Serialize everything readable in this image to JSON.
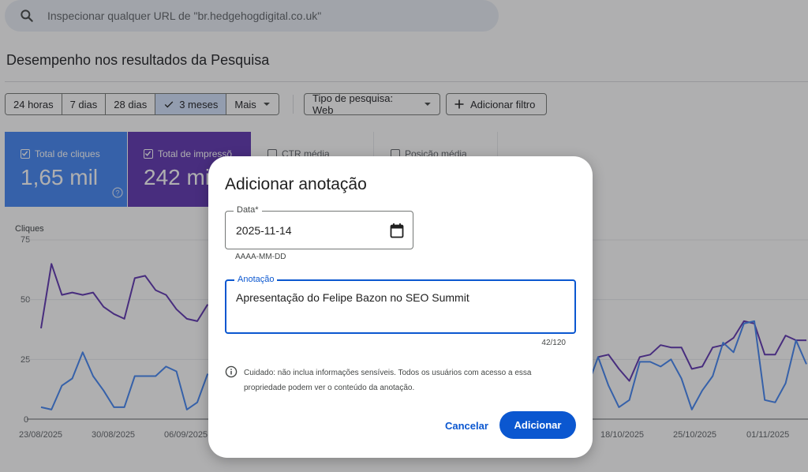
{
  "search": {
    "placeholder": "Inspecionar qualquer URL de \"br.hedgehogdigital.co.uk\""
  },
  "page_title": "Desempenho nos resultados da Pesquisa",
  "date_ranges": [
    {
      "label": "24 horas",
      "active": false
    },
    {
      "label": "7 dias",
      "active": false
    },
    {
      "label": "28 dias",
      "active": false
    },
    {
      "label": "3 meses",
      "active": true
    },
    {
      "label": "Mais",
      "active": false
    }
  ],
  "filters": {
    "search_type_label": "Tipo de pesquisa: Web",
    "add_filter_label": "Adicionar filtro"
  },
  "metrics": [
    {
      "label": "Total de cliques",
      "value": "1,65 mil",
      "checked": true,
      "color": "#4285f4"
    },
    {
      "label": "Total de impressõ",
      "value": "242 mi",
      "checked": true,
      "color": "#5e35b1"
    },
    {
      "label": "CTR média",
      "value": "",
      "checked": false,
      "color": "#ffffff"
    },
    {
      "label": "Posição média",
      "value": "",
      "checked": false,
      "color": "#ffffff"
    }
  ],
  "chart_data": {
    "type": "line",
    "ylabel": "Cliques",
    "yticks": [
      "75",
      "50",
      "25",
      "0"
    ],
    "ylim": [
      0,
      75
    ],
    "x": [
      "23/08/2025",
      "30/08/2025",
      "06/09/2025",
      "18/10/2025",
      "25/10/2025",
      "01/11/2025"
    ],
    "series": [
      {
        "color": "#5e35b1",
        "visible_start": [
          38,
          65,
          52,
          53,
          52,
          53,
          47,
          44,
          42,
          59,
          60,
          54,
          52,
          46,
          42,
          41,
          48
        ],
        "visible_end": [
          26,
          27,
          21,
          16,
          26,
          27,
          31,
          30,
          30,
          21,
          22,
          30,
          31,
          34,
          41,
          40,
          27,
          27,
          35,
          33,
          33
        ]
      },
      {
        "color": "#4285f4",
        "visible_start": [
          5,
          4,
          14,
          17,
          28,
          18,
          12,
          5,
          5,
          18,
          18,
          18,
          22,
          20,
          4,
          7,
          19
        ],
        "visible_end": [
          14,
          26,
          14,
          5,
          8,
          24,
          24,
          22,
          25,
          17,
          4,
          12,
          18,
          32,
          28,
          40,
          41,
          8,
          7,
          15,
          33,
          23
        ]
      }
    ]
  },
  "dialog": {
    "title": "Adicionar anotação",
    "date_label": "Data*",
    "date_value": "2025-11-14",
    "date_hint": "AAAA-MM-DD",
    "note_label": "Anotação",
    "note_value": "Apresentação do Felipe Bazon no SEO Summit",
    "counter": "42/120",
    "warning": "Cuidado: não inclua informações sensíveis. Todos os usuários com acesso a essa propriedade podem ver o conteúdo da anotação.",
    "cancel_label": "Cancelar",
    "submit_label": "Adicionar"
  }
}
